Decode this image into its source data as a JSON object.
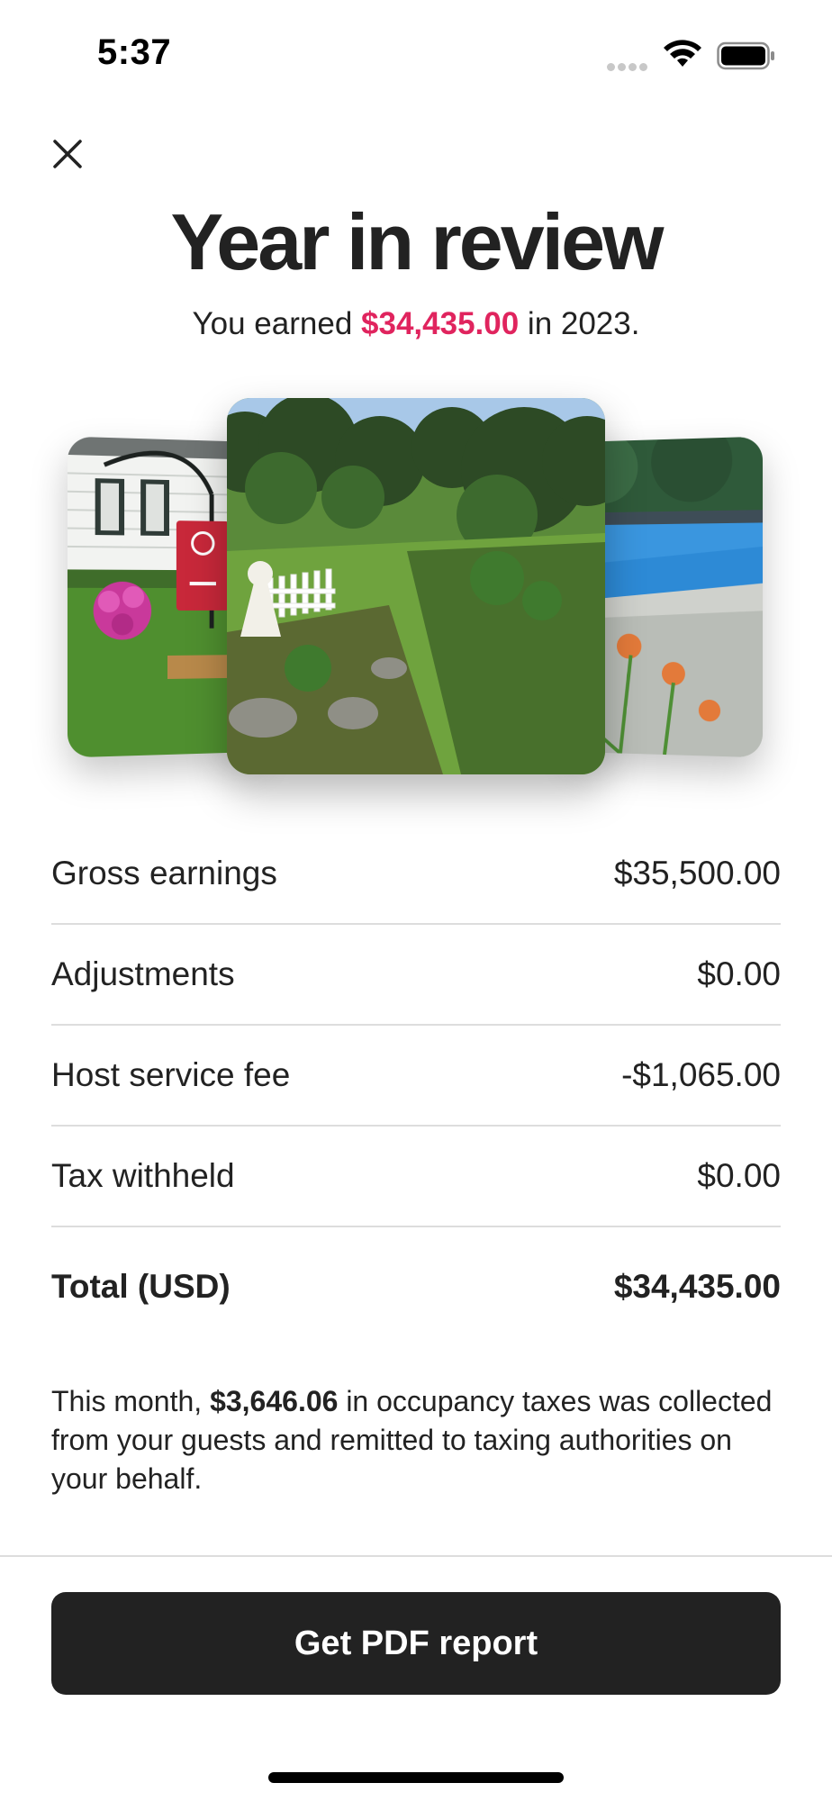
{
  "status_bar": {
    "time": "5:37",
    "icons": [
      "signal-icon",
      "wifi-icon",
      "battery-icon"
    ]
  },
  "header": {
    "close_icon": "close-icon",
    "title": "Year in review",
    "subtitle_prefix": "You earned ",
    "subtitle_amount": "$34,435.00",
    "subtitle_suffix": " in 2023."
  },
  "photos": [
    "house-with-airbnb-sign-photo",
    "garden-lawn-photo",
    "pool-with-lilies-photo"
  ],
  "earnings": {
    "rows": [
      {
        "label": "Gross earnings",
        "value": "$35,500.00"
      },
      {
        "label": "Adjustments",
        "value": "$0.00"
      },
      {
        "label": "Host service fee",
        "value": "-$1,065.00"
      },
      {
        "label": "Tax withheld",
        "value": "$0.00"
      }
    ],
    "total": {
      "label": "Total (USD)",
      "value": "$34,435.00"
    }
  },
  "note": {
    "prefix": "This month, ",
    "amount": "$3,646.06",
    "suffix": " in occupancy taxes was collected from your guests and remitted to taxing authorities on your behalf."
  },
  "footer": {
    "button_label": "Get PDF report"
  },
  "colors": {
    "accent": "#e0245e",
    "text": "#222222",
    "button_bg": "#222222",
    "divider": "#dddddd"
  }
}
